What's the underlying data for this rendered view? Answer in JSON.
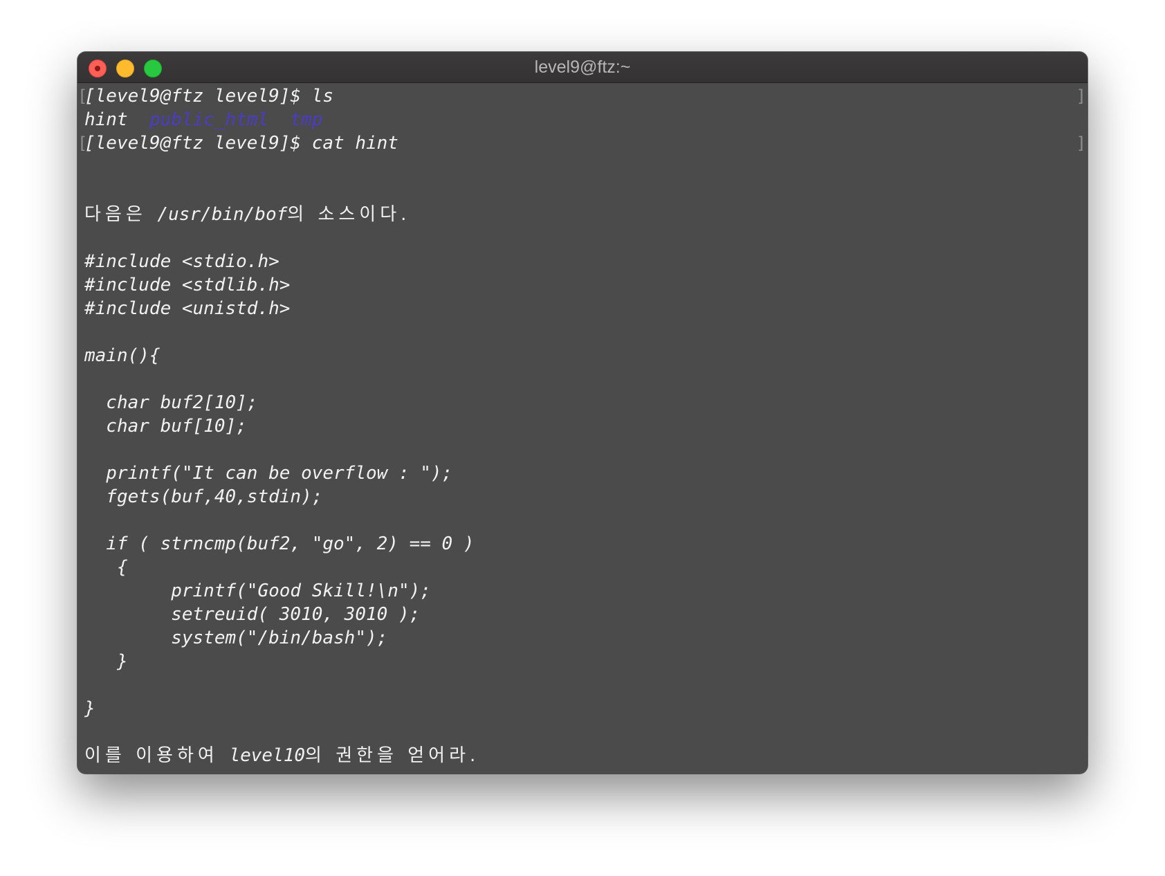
{
  "window": {
    "title": "level9@ftz:~"
  },
  "terminal": {
    "cmd1": "[level9@ftz level9]$ ls",
    "ls_output": {
      "file1": "hint",
      "dir1": "public_html",
      "dir2": "tmp"
    },
    "cmd2": "[level9@ftz level9]$ cat hint",
    "hint_intro": {
      "kr1": "다음은",
      "path": "/usr/bin/bof",
      "kr2": "의 소스이다."
    },
    "code": [
      "#include <stdio.h>",
      "#include <stdlib.h>",
      "#include <unistd.h>",
      "",
      "main(){",
      "",
      "  char buf2[10];",
      "  char buf[10];",
      "",
      "  printf(\"It can be overflow : \");",
      "  fgets(buf,40,stdin);",
      "",
      "  if ( strncmp(buf2, \"go\", 2) == 0 )",
      "   {",
      "        printf(\"Good Skill!\\n\");",
      "        setreuid( 3010, 3010 );",
      "        system(\"/bin/bash\");",
      "   }",
      "",
      "}"
    ],
    "hint_outro": {
      "kr1": "이를 이용하여",
      "level": "level10",
      "kr2": "의 권한을 얻어라."
    }
  },
  "colors": {
    "terminal_bg": "#4b4b4b",
    "text": "#f2f2f2",
    "directory": "#4a3cc7"
  }
}
